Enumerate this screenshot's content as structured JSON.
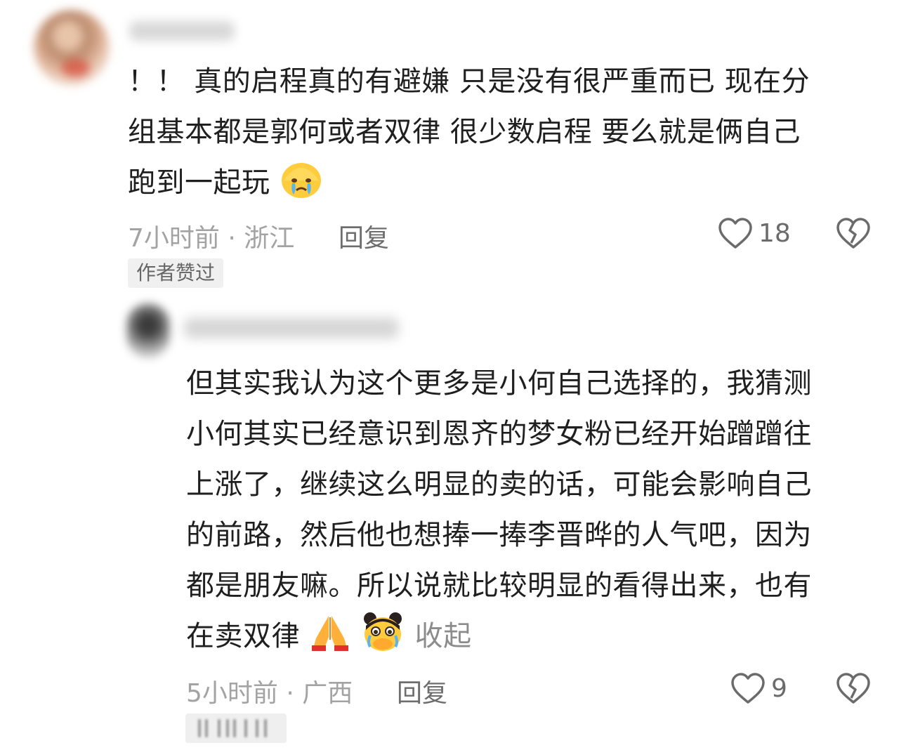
{
  "comment": {
    "text_lines": [
      "！！ 真的启程真的有避嫌 只是没有很严重而已 现在分",
      "组基本都是郭何或者双律 很少数启程 要么就是俩自己",
      "跑到一起玩"
    ],
    "emoji_after_text": "crying-face-emoji",
    "time": "7小时前 · 浙江",
    "reply_label": "回复",
    "like_count": "18",
    "author_liked_badge": "作者赞过"
  },
  "reply": {
    "text_lines": [
      "但其实我认为这个更多是小何自己选择的，我猜测",
      "小何其实已经意识到恩齐的梦女粉已经开始蹭蹭往",
      "上涨了，继续这么明显的卖的话，可能会影响自己",
      "的前路，然后他也想捧一捧李晋晔的人气吧，因为",
      "都是朋友嘛。所以说就比较明显的看得出来，也有",
      "在卖双律"
    ],
    "emojis": [
      "folded-hands-emoji",
      "crying-covering-mouth-emoji"
    ],
    "collapse_label": "收起",
    "time": "5小时前 · 广西",
    "reply_label": "回复",
    "like_count": "9"
  },
  "colors": {
    "text": "#1f1f1f",
    "meta": "#a3a3a3",
    "icon": "#6b6b6b",
    "badge_bg": "#f0f0f0"
  }
}
